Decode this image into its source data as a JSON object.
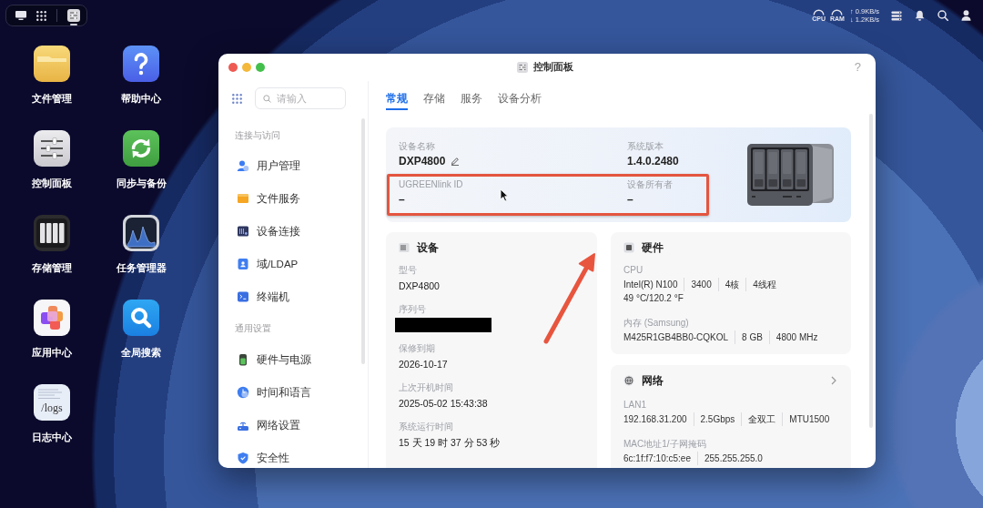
{
  "taskbar": {
    "apps": [
      {
        "kind": "control-panel",
        "running": true
      }
    ],
    "status": {
      "cpu_label": "CPU",
      "ram_label": "RAM",
      "upload": "↑ 0.9KB/s",
      "download": "↓ 1.2KB/s"
    }
  },
  "desktop_apps": [
    {
      "label": "文件管理",
      "kind": "files"
    },
    {
      "label": "帮助中心",
      "kind": "help"
    },
    {
      "label": "控制面板",
      "kind": "control-panel"
    },
    {
      "label": "同步与备份",
      "kind": "sync"
    },
    {
      "label": "存储管理",
      "kind": "storage"
    },
    {
      "label": "任务管理器",
      "kind": "task-manager"
    },
    {
      "label": "应用中心",
      "kind": "app-center"
    },
    {
      "label": "全局搜索",
      "kind": "search"
    },
    {
      "label": "日志中心",
      "kind": "logs",
      "icon_text": "/logs"
    }
  ],
  "window": {
    "title": "控制面板",
    "help": "?"
  },
  "sidebar": {
    "search": {
      "placeholder": "请输入"
    },
    "sections": [
      {
        "title": "连接与访问",
        "items": [
          {
            "label": "用户管理",
            "kind": "users"
          },
          {
            "label": "文件服务",
            "kind": "files"
          },
          {
            "label": "设备连接",
            "kind": "devices"
          },
          {
            "label": "域/LDAP",
            "kind": "ldap"
          },
          {
            "label": "终端机",
            "kind": "terminal"
          }
        ]
      },
      {
        "title": "通用设置",
        "items": [
          {
            "label": "硬件与电源",
            "kind": "power"
          },
          {
            "label": "时间和语言",
            "kind": "time"
          },
          {
            "label": "网络设置",
            "kind": "network"
          },
          {
            "label": "安全性",
            "kind": "security"
          }
        ]
      }
    ]
  },
  "tabs": [
    {
      "label": "常规",
      "selected": true
    },
    {
      "label": "存储",
      "selected": false
    },
    {
      "label": "服务",
      "selected": false
    },
    {
      "label": "设备分析",
      "selected": false
    }
  ],
  "overview": {
    "fields": [
      {
        "label": "设备名称",
        "value": "DXP4800",
        "editable": true
      },
      {
        "label": "系统版本",
        "value": "1.4.0.2480",
        "editable": false
      },
      {
        "label": "UGREENlink ID",
        "value": "–",
        "editable": false
      },
      {
        "label": "设备所有者",
        "value": "–",
        "editable": false
      }
    ]
  },
  "device_card": {
    "title": "设备",
    "fields": [
      {
        "label": "型号",
        "kind": "text",
        "value": "DXP4800"
      },
      {
        "label": "序列号",
        "kind": "redacted"
      },
      {
        "label": "保修到期",
        "kind": "text",
        "value": "2026-10-17"
      },
      {
        "label": "上次开机时间",
        "kind": "text",
        "value": "2025-05-02 15:43:38"
      },
      {
        "label": "系统运行时间",
        "kind": "text",
        "value": "15 天 19 时 37 分 53 秒"
      }
    ]
  },
  "hardware_card": {
    "title": "硬件",
    "groups": [
      {
        "label": "CPU",
        "lines": [
          [
            "Intel(R) N100",
            "3400",
            "4核",
            "4线程"
          ],
          [
            "49 °C/120.2 °F"
          ]
        ]
      },
      {
        "label": "内存 (Samsung)",
        "lines": [
          [
            "M425R1GB4BB0-CQKOL",
            "8 GB",
            "4800 MHz"
          ]
        ]
      }
    ]
  },
  "network_card": {
    "title": "网络",
    "groups": [
      {
        "label": "LAN1",
        "lines": [
          [
            "192.168.31.200",
            "2.5Gbps",
            "全双工",
            "MTU1500"
          ]
        ]
      },
      {
        "label": "MAC地址1/子网掩码",
        "lines": [
          [
            "6c:1f:f7:10:c5:ee",
            "255.255.255.0"
          ]
        ]
      }
    ]
  },
  "annotations": {
    "highlight_box": true,
    "arrow": true
  }
}
